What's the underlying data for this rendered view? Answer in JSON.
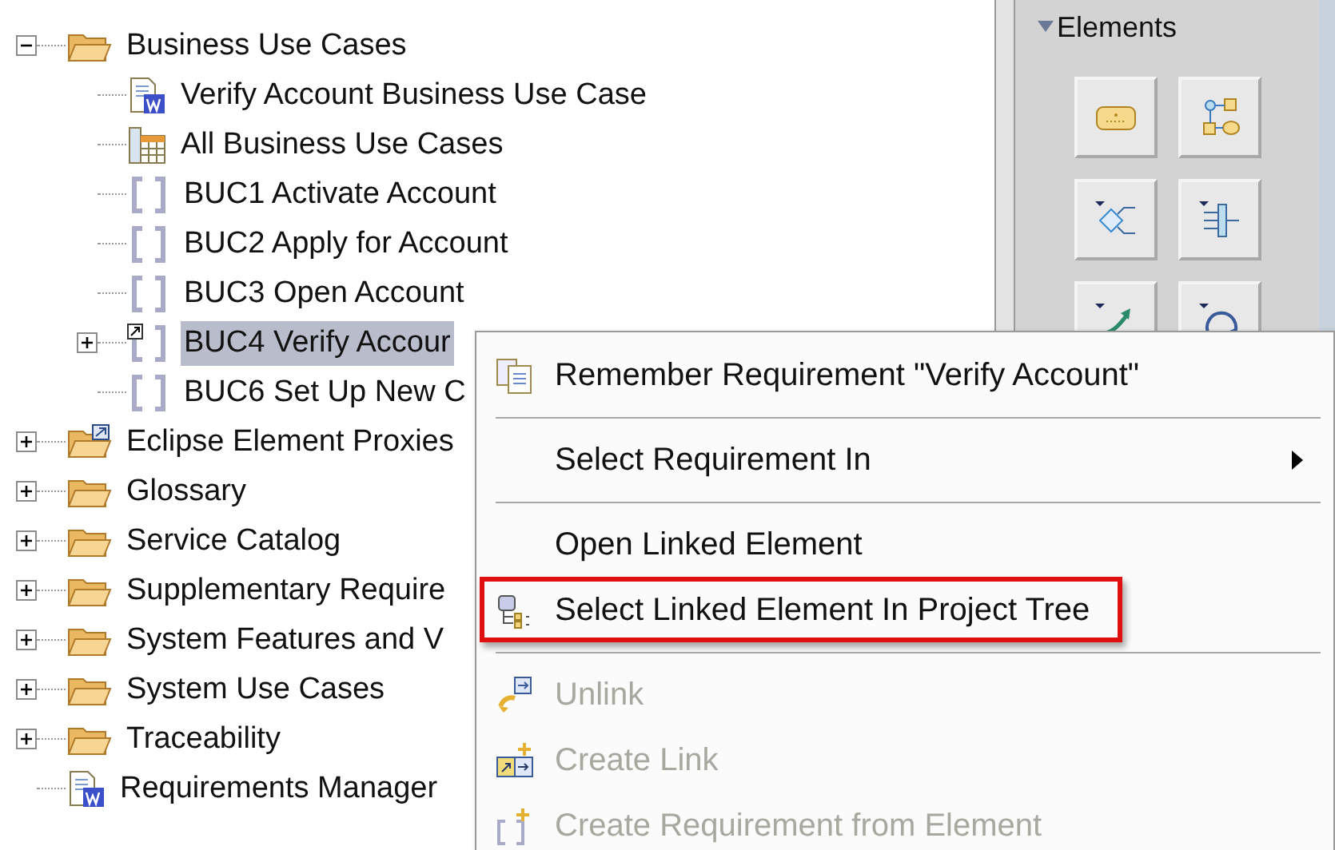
{
  "tree": [
    {
      "label": "Business Use Cases",
      "kind": "folder",
      "expanded": true,
      "selected": false,
      "children": [
        {
          "label": "Verify Account Business Use Case",
          "kind": "document",
          "selected": false
        },
        {
          "label": "All Business Use Cases",
          "kind": "table",
          "selected": false
        },
        {
          "label": "BUC1 Activate Account",
          "kind": "requirement",
          "selected": false
        },
        {
          "label": "BUC2 Apply for Account",
          "kind": "requirement",
          "selected": false
        },
        {
          "label": "BUC3 Open Account",
          "kind": "requirement",
          "selected": false
        },
        {
          "label": "BUC4 Verify Accour",
          "kind": "linked-requirement",
          "expanded": false,
          "selected": true
        },
        {
          "label": "BUC6 Set Up New C",
          "kind": "requirement",
          "selected": false
        }
      ]
    },
    {
      "label": "Eclipse Element Proxies",
      "kind": "proxy-folder",
      "expanded": false,
      "selected": false
    },
    {
      "label": "Glossary",
      "kind": "folder",
      "expanded": false,
      "selected": false
    },
    {
      "label": "Service Catalog",
      "kind": "folder",
      "expanded": false,
      "selected": false
    },
    {
      "label": "Supplementary Require",
      "kind": "folder",
      "expanded": false,
      "selected": false
    },
    {
      "label": "System Features and V",
      "kind": "folder",
      "expanded": false,
      "selected": false
    },
    {
      "label": "System Use Cases",
      "kind": "folder",
      "expanded": false,
      "selected": false
    },
    {
      "label": "Traceability",
      "kind": "folder",
      "expanded": false,
      "selected": false
    },
    {
      "label": "Requirements Manager",
      "kind": "document",
      "selected": false
    }
  ],
  "palette": {
    "title": "Elements",
    "expanded": true,
    "tools": [
      {
        "kind": "block"
      },
      {
        "kind": "graph"
      },
      {
        "kind": "decision"
      },
      {
        "kind": "fork"
      },
      {
        "kind": "flow"
      },
      {
        "kind": "loop"
      }
    ]
  },
  "context_menu": {
    "items": [
      {
        "kind": "copy",
        "label": "Remember Requirement \"Verify Account\"",
        "disabled": false,
        "highlighted": false
      },
      {
        "kind": "separator"
      },
      {
        "kind": "submenu",
        "label": "Select Requirement In",
        "disabled": false,
        "highlighted": false
      },
      {
        "kind": "separator"
      },
      {
        "kind": "item",
        "label": "Open Linked Element",
        "disabled": false,
        "highlighted": false
      },
      {
        "kind": "tree",
        "label": "Select Linked Element In Project Tree",
        "disabled": false,
        "highlighted": true
      },
      {
        "kind": "separator"
      },
      {
        "kind": "unlink",
        "label": "Unlink",
        "disabled": true,
        "highlighted": false
      },
      {
        "kind": "link",
        "label": "Create Link",
        "disabled": true,
        "highlighted": false
      },
      {
        "kind": "create",
        "label": "Create Requirement from Element",
        "disabled": true,
        "highlighted": false
      }
    ]
  }
}
